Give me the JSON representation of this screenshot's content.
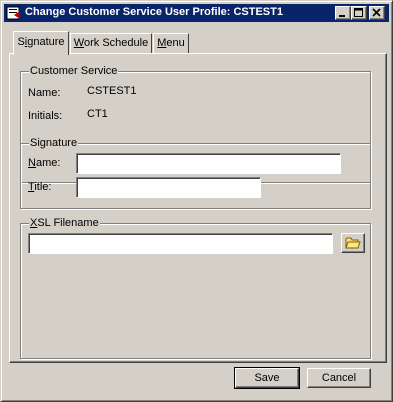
{
  "window": {
    "title": "Change Customer Service User Profile: CSTEST1"
  },
  "tabs": [
    {
      "pre": "S",
      "accel": "i",
      "post": "gnature"
    },
    {
      "pre": "",
      "accel": "W",
      "post": "ork Schedule"
    },
    {
      "pre": "",
      "accel": "M",
      "post": "enu"
    }
  ],
  "customer_service": {
    "title": "Customer Service",
    "name_label": "Name:",
    "name_value": "CSTEST1",
    "initials_label": "Initials:",
    "initials_value": "CT1"
  },
  "signature": {
    "title": "Signature",
    "name_accel": "N",
    "name_rest": "ame:",
    "name_value": "",
    "title_accel": "T",
    "title_rest": "itle:",
    "title_value": ""
  },
  "xsl": {
    "accel": "X",
    "title_rest": "SL Filename",
    "value": ""
  },
  "buttons": {
    "save": "Save",
    "cancel": "Cancel"
  },
  "colors": {
    "titlebar": "#0a246a",
    "face": "#d4d0c8"
  }
}
